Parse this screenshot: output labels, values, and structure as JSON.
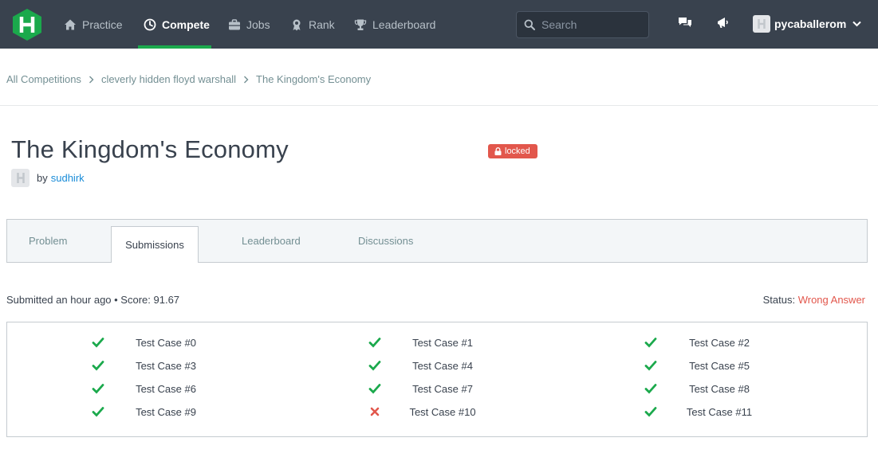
{
  "nav": {
    "items": [
      {
        "label": "Practice",
        "icon": "home-icon"
      },
      {
        "label": "Compete",
        "icon": "clock-icon",
        "active": true
      },
      {
        "label": "Jobs",
        "icon": "briefcase-icon"
      },
      {
        "label": "Rank",
        "icon": "ribbon-icon"
      },
      {
        "label": "Leaderboard",
        "icon": "trophy-icon"
      }
    ],
    "search_placeholder": "Search",
    "username": "pycaballerom",
    "accent": "#1ba94c",
    "background": "#39424e"
  },
  "breadcrumb": {
    "items": [
      "All Competitions",
      "cleverly hidden floyd warshall",
      "The Kingdom's Economy"
    ]
  },
  "challenge": {
    "title": "The Kingdom's Economy",
    "badge": "locked",
    "by": "by",
    "author": "sudhirk"
  },
  "tabs": [
    "Problem",
    "Submissions",
    "Leaderboard",
    "Discussions"
  ],
  "submission": {
    "info": "Submitted an hour ago • Score: 91.67",
    "status_label": "Status:",
    "status_value": "Wrong Answer",
    "status_color": "#e2574c",
    "pass_color": "#1ba94c",
    "test_cases": [
      {
        "label": "Test Case #0",
        "passed": true
      },
      {
        "label": "Test Case #1",
        "passed": true
      },
      {
        "label": "Test Case #2",
        "passed": true
      },
      {
        "label": "Test Case #3",
        "passed": true
      },
      {
        "label": "Test Case #4",
        "passed": true
      },
      {
        "label": "Test Case #5",
        "passed": true
      },
      {
        "label": "Test Case #6",
        "passed": true
      },
      {
        "label": "Test Case #7",
        "passed": true
      },
      {
        "label": "Test Case #8",
        "passed": true
      },
      {
        "label": "Test Case #9",
        "passed": true
      },
      {
        "label": "Test Case #10",
        "passed": false
      },
      {
        "label": "Test Case #11",
        "passed": true
      }
    ]
  }
}
